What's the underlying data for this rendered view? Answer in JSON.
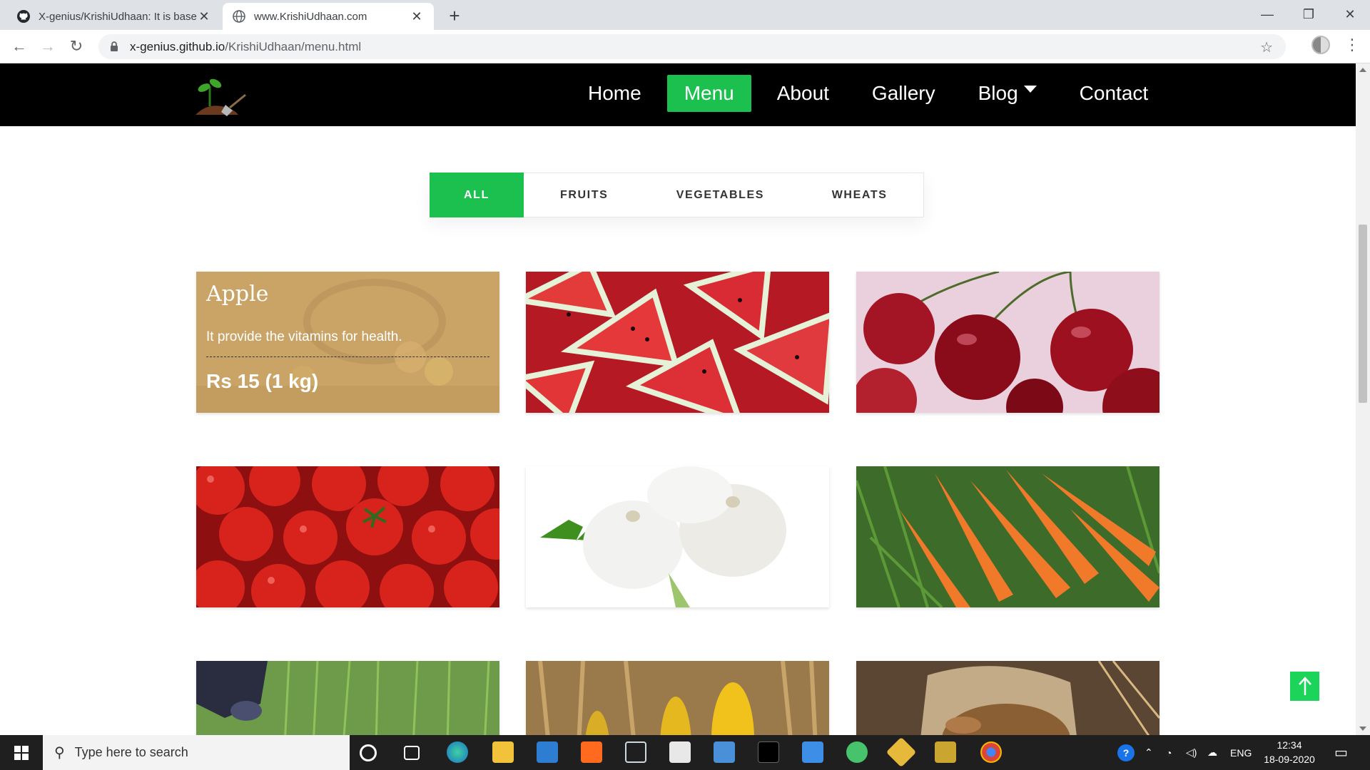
{
  "browser": {
    "tabs": [
      {
        "title": "X-genius/KrishiUdhaan: It is base",
        "icon": "github-icon"
      },
      {
        "title": "www.KrishiUdhaan.com",
        "icon": "globe-icon"
      }
    ],
    "new_tab": "+",
    "url_host": "x-genius.github.io",
    "url_path": "/KrishiUdhaan/menu.html"
  },
  "site": {
    "nav": {
      "items": [
        {
          "label": "Home"
        },
        {
          "label": "Menu",
          "active": true
        },
        {
          "label": "About"
        },
        {
          "label": "Gallery"
        },
        {
          "label": "Blog",
          "dropdown": true
        },
        {
          "label": "Contact"
        }
      ]
    },
    "filters": [
      {
        "label": "ALL",
        "active": true
      },
      {
        "label": "FRUITS"
      },
      {
        "label": "VEGETABLES"
      },
      {
        "label": "WHEATS"
      }
    ],
    "products": [
      {
        "name": "Apple",
        "description": "It provide the vitamins for health.",
        "price": "Rs 15 (1 kg)",
        "image": "apple-basket"
      },
      {
        "image": "watermelon"
      },
      {
        "image": "cherries"
      },
      {
        "image": "tomatoes"
      },
      {
        "image": "garlic"
      },
      {
        "image": "carrots"
      },
      {
        "image": "rice-field"
      },
      {
        "image": "corn"
      },
      {
        "image": "wheat-grains"
      }
    ],
    "colors": {
      "accent": "#1cc04f",
      "nav_bg": "#000000"
    }
  },
  "taskbar": {
    "search_placeholder": "Type here to search",
    "language": "ENG",
    "time": "12:34",
    "date": "18-09-2020"
  }
}
